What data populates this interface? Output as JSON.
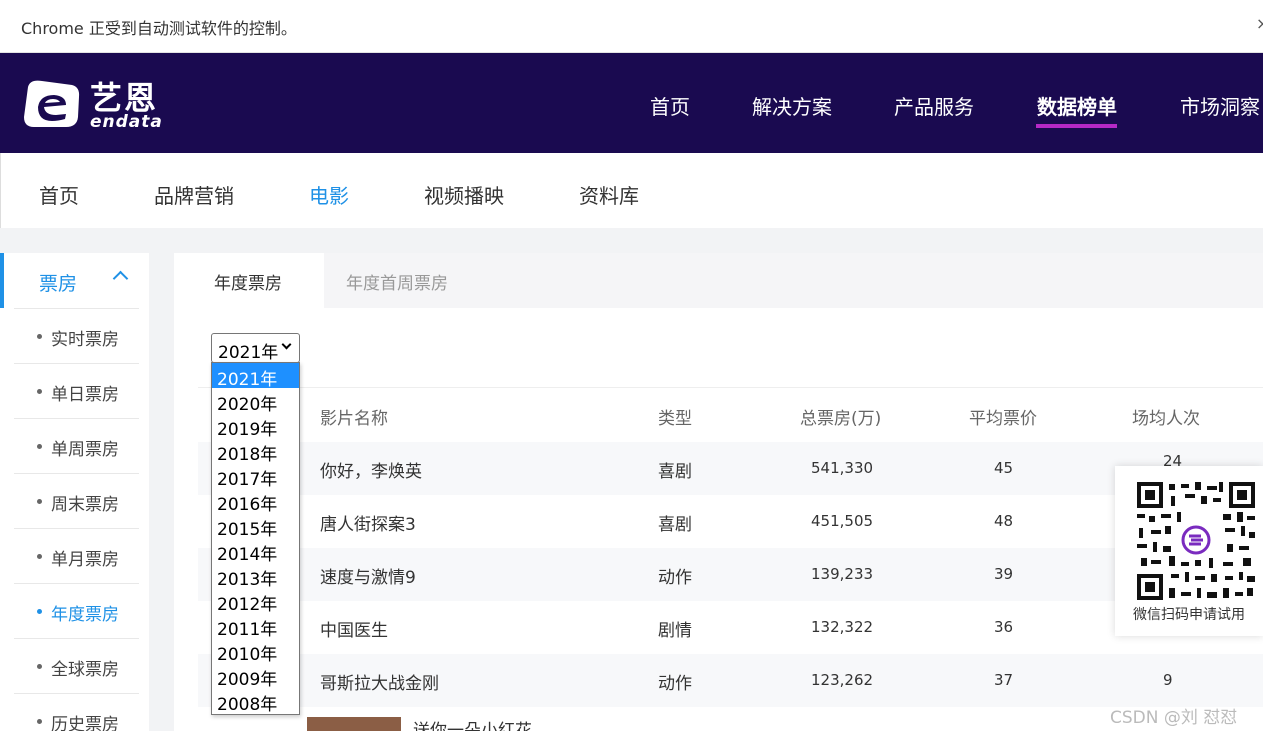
{
  "browser": {
    "automation_notice": "Chrome 正受到自动测试软件的控制。",
    "close_glyph": "×"
  },
  "brand": {
    "name_cn": "艺恩",
    "name_en": "endata"
  },
  "topnav": {
    "items": [
      "首页",
      "解决方案",
      "产品服务",
      "数据榜单",
      "市场洞察"
    ],
    "active": "数据榜单",
    "accent": "#b629c6",
    "background": "#1a0a50"
  },
  "subnav": {
    "items": [
      "首页",
      "品牌营销",
      "电影",
      "视频播映",
      "资料库"
    ],
    "active": "电影",
    "accent": "#1f91e6"
  },
  "sidebar": {
    "section": "票房",
    "items": [
      "实时票房",
      "单日票房",
      "单周票房",
      "周末票房",
      "单月票房",
      "年度票房",
      "全球票房",
      "历史票房"
    ],
    "active": "年度票房"
  },
  "tabs": {
    "items": [
      "年度票房",
      "年度首周票房"
    ],
    "active": "年度票房"
  },
  "year_select": {
    "value": "2021年",
    "options": [
      "2021年",
      "2020年",
      "2019年",
      "2018年",
      "2017年",
      "2016年",
      "2015年",
      "2014年",
      "2013年",
      "2012年",
      "2011年",
      "2010年",
      "2009年",
      "2008年"
    ]
  },
  "table": {
    "headers": [
      "影片名称",
      "类型",
      "总票房(万)",
      "平均票价",
      "场均人次"
    ],
    "rows": [
      {
        "name": "你好，李焕英",
        "genre": "喜剧",
        "box_office": "541,330",
        "avg_price": "45",
        "avg_attendance": "24"
      },
      {
        "name": "唐人街探案3",
        "genre": "喜剧",
        "box_office": "451,505",
        "avg_price": "48",
        "avg_attendance": ""
      },
      {
        "name": "速度与激情9",
        "genre": "动作",
        "box_office": "139,233",
        "avg_price": "39",
        "avg_attendance": ""
      },
      {
        "name": "中国医生",
        "genre": "剧情",
        "box_office": "132,322",
        "avg_price": "36",
        "avg_attendance": ""
      },
      {
        "name": "哥斯拉大战金刚",
        "genre": "动作",
        "box_office": "123,262",
        "avg_price": "37",
        "avg_attendance": "9"
      }
    ],
    "next_row_title": "送你一朵小红花"
  },
  "qr": {
    "caption": "微信扫码申请试用"
  },
  "watermark": "CSDN @刘 怼怼"
}
